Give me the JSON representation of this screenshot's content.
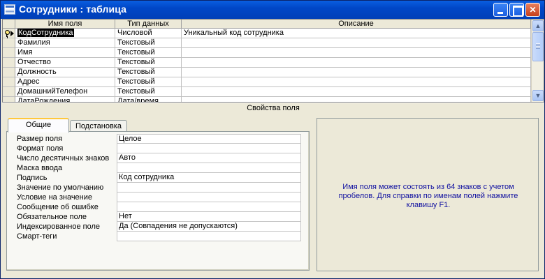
{
  "window": {
    "title": "Сотрудники : таблица"
  },
  "grid": {
    "columns": [
      "Имя поля",
      "Тип данных",
      "Описание"
    ],
    "rows": [
      {
        "name": "КодСотрудника",
        "type": "Числовой",
        "description": "Уникальный код сотрудника"
      },
      {
        "name": "Фамилия",
        "type": "Текстовый",
        "description": ""
      },
      {
        "name": "Имя",
        "type": "Текстовый",
        "description": ""
      },
      {
        "name": "Отчество",
        "type": "Текстовый",
        "description": ""
      },
      {
        "name": "Должность",
        "type": "Текстовый",
        "description": ""
      },
      {
        "name": "Адрес",
        "type": "Текстовый",
        "description": ""
      },
      {
        "name": "ДомашнийТелефон",
        "type": "Текстовый",
        "description": ""
      },
      {
        "name": "ДатаРождения",
        "type": "Дата/время",
        "description": ""
      }
    ]
  },
  "properties": {
    "section_title": "Свойства поля",
    "tabs": [
      "Общие",
      "Подстановка"
    ],
    "items": [
      {
        "label": "Размер поля",
        "value": "Целое"
      },
      {
        "label": "Формат поля",
        "value": ""
      },
      {
        "label": "Число десятичных знаков",
        "value": "Авто"
      },
      {
        "label": "Маска ввода",
        "value": ""
      },
      {
        "label": "Подпись",
        "value": "Код сотрудника"
      },
      {
        "label": "Значение по умолчанию",
        "value": ""
      },
      {
        "label": "Условие на значение",
        "value": ""
      },
      {
        "label": "Сообщение об ошибке",
        "value": ""
      },
      {
        "label": "Обязательное поле",
        "value": "Нет"
      },
      {
        "label": "Индексированное поле",
        "value": "Да (Совпадения не допускаются)"
      },
      {
        "label": "Смарт-теги",
        "value": ""
      }
    ],
    "hint": "Имя поля может состоять из 64 знаков с учетом пробелов.  Для справки по именам полей нажмите клавишу F1."
  }
}
